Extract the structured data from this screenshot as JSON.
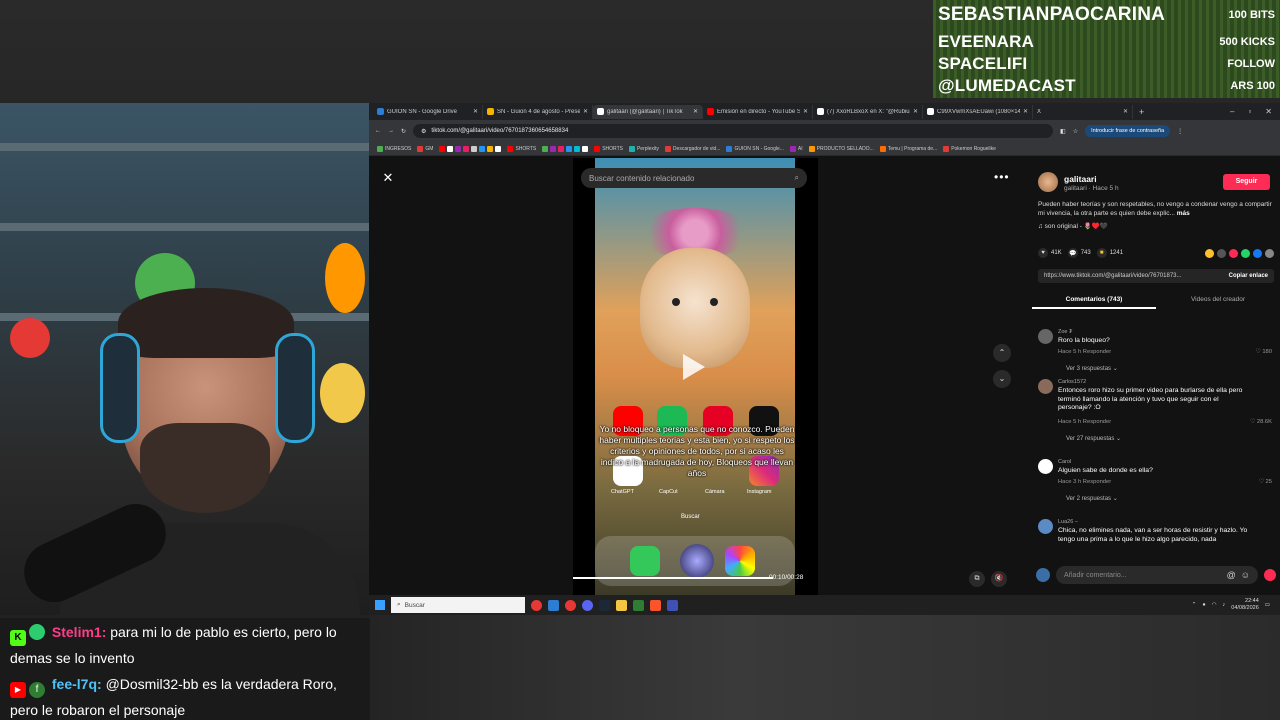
{
  "donations": [
    {
      "name": "SEBASTIANPAOCARINA",
      "value": "100 BITS"
    },
    {
      "name": "EVEENARA",
      "value": "500 KICKS"
    },
    {
      "name": "SPACELIFI",
      "value": "FOLLOW"
    },
    {
      "name": "@LUMEDACAST",
      "value": "ARS 100"
    }
  ],
  "browser": {
    "tabs": [
      {
        "label": "GUION SN - Google Drive",
        "color": "#2d7dd2"
      },
      {
        "label": "SN - Guion 4 de agosto - Prese",
        "color": "#f4b400"
      },
      {
        "label": "galitaari (@galitaari) | TikTok",
        "color": "#ffffff"
      },
      {
        "label": "Emisión en directo - YouTube S",
        "color": "#ff0000"
      },
      {
        "label": "(7) XxoRLBxoX en X: \"@Rubiu5",
        "color": "#ffffff"
      },
      {
        "label": "C99XVwmXsAEUawi (1080×14",
        "color": "#ffffff"
      },
      {
        "label": "X",
        "color": "#ffffff"
      }
    ],
    "url": "tiktok.com/@galitaari/video/7670187360654658834",
    "password_prompt": "Introducir frase de contraseña",
    "bookmarks": [
      {
        "label": "INGRESOS",
        "color": "#4caf50"
      },
      {
        "label": "GM",
        "color": "#e53935"
      },
      {
        "label": "SHORTS",
        "color": "#ff0000"
      },
      {
        "label": "SHORTS",
        "color": "#ff0000"
      },
      {
        "label": "Perplexity",
        "color": "#20b2aa"
      },
      {
        "label": "Descargador de vid...",
        "color": "#e53935"
      },
      {
        "label": "GUION SN - Google...",
        "color": "#2d7dd2"
      },
      {
        "label": "AI",
        "color": "#9c27b0"
      },
      {
        "label": "PRODUCTO SELLADO...",
        "color": "#ff9800"
      },
      {
        "label": "Temu | Programa de...",
        "color": "#ff6d00"
      },
      {
        "label": "Pokemon Roguelike",
        "color": "#e53935"
      }
    ]
  },
  "viewer": {
    "search_placeholder": "Buscar contenido relacionado",
    "video_text": "Yo no bloqueo a personas que no conozco. Pueden haber multiples teorias y esta bien, yo si respeto los criterios y opiniones de todos, por si acaso les indico a la madrugada de hoy, Bloqueos que llevan años",
    "app_labels": [
      "ChatGPT",
      "CapCut",
      "Cámara",
      "Instagram"
    ],
    "dock_search": "Buscar",
    "time": "00:10/00:28",
    "progress": 1.0
  },
  "panel": {
    "author": "galitaari",
    "author_sub": "galitaari · Hace 5 h",
    "follow": "Seguir",
    "description": "Pueden haber teorías y son respetables, no vengo a condenar vengo a compartir mi vivencia, la otra parte es quien debe explic...",
    "more": "más",
    "sound": "♫  son original - 🌷♥️🖤",
    "stats": {
      "likes": "41K",
      "comments": "743",
      "saves": "1241"
    },
    "link": "https://www.tiktok.com/@galitaari/video/76701873...",
    "copy_link": "Copiar enlace",
    "tab_comments": "Comentarios (743)",
    "tab_creator": "Videos del creador",
    "comments": [
      {
        "user": "Zoe ₮",
        "text": "Roro la bloqueo?",
        "meta": "Hace 5 h   Responder",
        "likes": "♡ 180",
        "replies": "Ver 3 respuestas ⌄",
        "color": "#666"
      },
      {
        "user": "Carlos1572",
        "text": "Entonces roro hizo su primer video para burlarse de ella pero terminó llamando la atención y tuvo que seguir con el personaje? :O",
        "meta": "Hace 5 h   Responder",
        "likes": "♡ 28.6K",
        "replies": "Ver 27 respuestas ⌄",
        "color": "#8a6a5a"
      },
      {
        "user": "Carol",
        "text": "Alguien sabe de donde es ella?",
        "meta": "Hace 3 h   Responder",
        "likes": "♡ 25",
        "replies": "Ver 2 respuestas ⌄",
        "color": "#ffffff"
      },
      {
        "user": "Lua26 –",
        "text": "Chica, no elimines nada, van a ser horas de resistir y hazlo. Yo tengo una prima a lo que le hizo algo parecido, nada",
        "meta": "",
        "likes": "",
        "replies": "",
        "color": "#5a8bc4"
      }
    ],
    "comment_placeholder": "Añadir comentario..."
  },
  "taskbar": {
    "search": "Buscar",
    "time": "22:44",
    "date": "04/08/2026"
  },
  "chat": [
    {
      "user": "Stelim1:",
      "text": "para mi lo de pablo es cierto, pero lo demas se lo invento",
      "platform": "K",
      "platform_color": "#53fc18",
      "user_color": "#ff3c8a"
    },
    {
      "user": "fee-l7q:",
      "text": "@Dosmil32-bb es la verdadera Roro, pero le robaron el personaje",
      "platform": "▶",
      "platform_color": "#ff0000",
      "user_color": "#4fc3f7"
    }
  ]
}
